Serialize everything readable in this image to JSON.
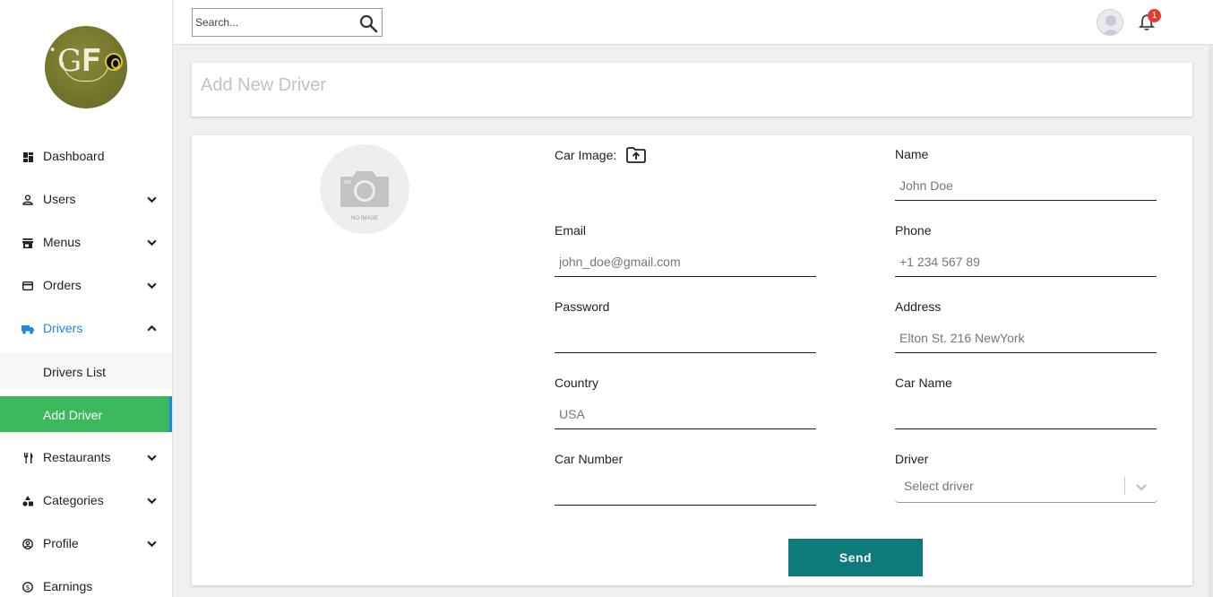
{
  "search": {
    "placeholder": "Search..."
  },
  "notifications": {
    "count": "1",
    "badge_color": "#e53935"
  },
  "sidebar": {
    "items": [
      {
        "label": "Dashboard",
        "icon": "dashboard-icon"
      },
      {
        "label": "Users",
        "icon": "user-icon"
      },
      {
        "label": "Menus",
        "icon": "storefront-icon"
      },
      {
        "label": "Orders",
        "icon": "credit-card-icon"
      },
      {
        "label": "Drivers",
        "icon": "truck-icon",
        "expanded": true
      },
      {
        "label": "Restaurants",
        "icon": "restaurant-icon"
      },
      {
        "label": "Categories",
        "icon": "category-icon"
      },
      {
        "label": "Profile",
        "icon": "account-circle-icon"
      },
      {
        "label": "Earnings",
        "icon": "dollar-icon"
      }
    ],
    "drivers_sub": [
      {
        "label": "Drivers List"
      },
      {
        "label": "Add Driver",
        "selected": true
      }
    ],
    "active_color": "#1e88e5",
    "selected_bg": "#3cb95d"
  },
  "page": {
    "title": "Add New Driver"
  },
  "photo": {
    "placeholder_text": "NO IMAGE"
  },
  "form": {
    "car_image_label": "Car Image:",
    "name": {
      "label": "Name",
      "placeholder": "John Doe",
      "value": ""
    },
    "email": {
      "label": "Email",
      "placeholder": "john_doe@gmail.com",
      "value": ""
    },
    "phone": {
      "label": "Phone",
      "placeholder": "+1 234 567 89",
      "value": ""
    },
    "password": {
      "label": "Password",
      "placeholder": "",
      "value": ""
    },
    "address": {
      "label": "Address",
      "placeholder": "Elton St. 216 NewYork",
      "value": ""
    },
    "country": {
      "label": "Country",
      "placeholder": "USA",
      "value": ""
    },
    "car_name": {
      "label": "Car Name",
      "placeholder": "",
      "value": ""
    },
    "car_number": {
      "label": "Car Number",
      "placeholder": "",
      "value": ""
    },
    "driver": {
      "label": "Driver",
      "selected": "Select driver"
    },
    "submit_label": "Send",
    "submit_color": "#0e7a7b"
  }
}
